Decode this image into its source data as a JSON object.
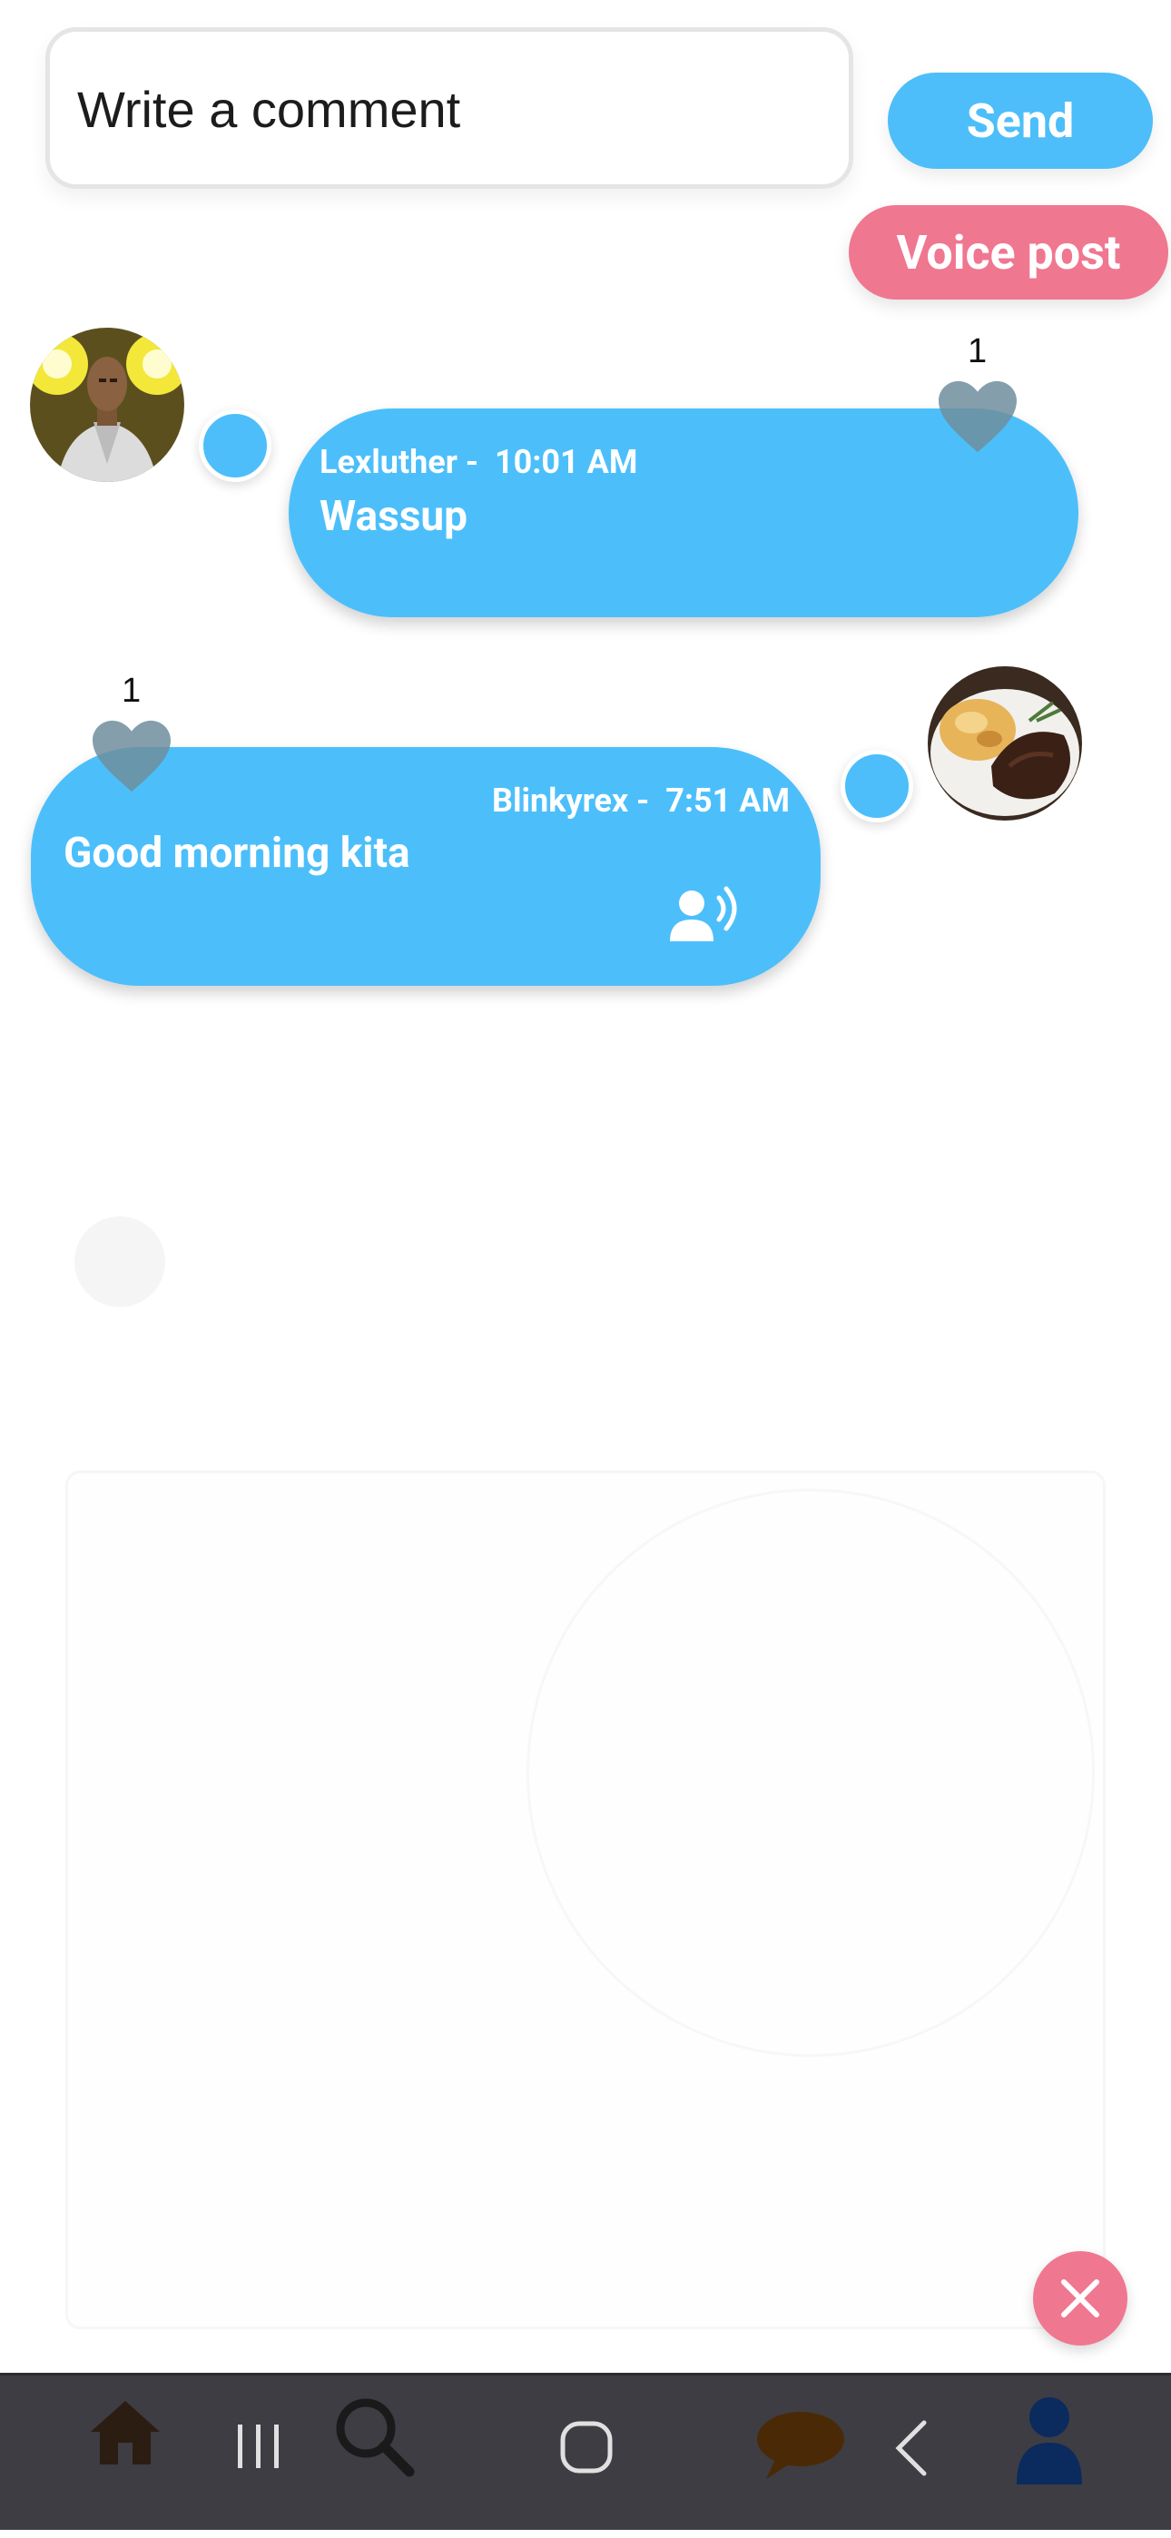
{
  "comment": {
    "placeholder": "Write a comment",
    "send_label": "Send",
    "voice_post_label": "Voice post"
  },
  "messages": [
    {
      "author": "Lexluther",
      "time": "10:01 AM",
      "text": "Wassup",
      "likes": "1",
      "alignment": "left",
      "voice": false
    },
    {
      "author": "Blinkyrex",
      "time": "7:51 AM",
      "text": "Good morning kita",
      "likes": "1",
      "alignment": "right",
      "voice": true
    }
  ],
  "colors": {
    "bubble": "#4cbffb",
    "send": "#4dbef9",
    "voice_post": "#f07790",
    "close": "#f07790",
    "heart": "#6f8e9c",
    "nav_bar": "#3d3d43"
  },
  "icons": {
    "voice": "voice-message-icon",
    "like": "heart-icon",
    "close": "close-icon",
    "nav": [
      "home-icon",
      "search-icon",
      "recents-icon",
      "home-button-icon",
      "chat-icon",
      "back-icon",
      "profile-icon"
    ]
  }
}
